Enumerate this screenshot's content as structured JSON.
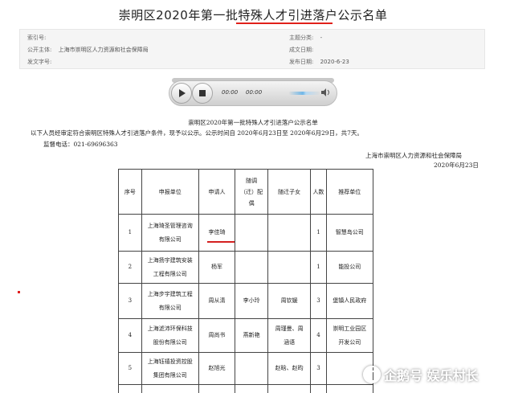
{
  "page": {
    "title": "崇明区2020年第一批特殊人才引进落户公示名单"
  },
  "meta": {
    "index_label": "索引号:",
    "index_value": "",
    "category_label": "主题分类:",
    "category_value": "-",
    "publisher_label": "公开主体:",
    "publisher_value": "上海市崇明区人力资源和社会保障局",
    "created_label": "成文日期:",
    "created_value": "",
    "docno_label": "发文字号:",
    "docno_value": "",
    "published_label": "发布日期:",
    "published_value": "2020-6-23"
  },
  "player": {
    "current_time": "00:00",
    "total_time": "00:00",
    "volume_level": 0.55,
    "play_icon": "play-icon",
    "stop_icon": "stop-icon",
    "volume_icon": "speaker-icon"
  },
  "doc": {
    "heading": "崇明区2020年第一批特殊人才引进落户公示名单",
    "intro": "以下人员经审定符合崇明区特殊人才引进落户条件，现予以公示。公示时间自 2020年6月23日至 2020年6月29日，共7天。",
    "phone": "监督电话：021-69696363",
    "issuer": "上海市崇明区人力资源和社会保障局",
    "issue_date": "2020年6月23日"
  },
  "table": {
    "headers": {
      "seq": "序号",
      "unit": "申报单位",
      "applicant": "申请人",
      "spouse_l1": "随调",
      "spouse_l2": "（迁）配",
      "spouse_l3": "偶",
      "children": "随迁子女",
      "count": "人数",
      "recommender": "推荐单位"
    },
    "rows": [
      {
        "seq": "1",
        "unit_l1": "上海琦圣管理咨询",
        "unit_l2": "有限公司",
        "applicant": "李佳琦",
        "spouse": "",
        "children_l1": "",
        "children_l2": "",
        "count": "1",
        "recommender_l1": "智慧岛公司",
        "recommender_l2": ""
      },
      {
        "seq": "2",
        "unit_l1": "上海扬宇建筑安装",
        "unit_l2": "工程有限公司",
        "applicant": "杨军",
        "spouse": "",
        "children_l1": "",
        "children_l2": "",
        "count": "1",
        "recommender_l1": "能投公司",
        "recommender_l2": ""
      },
      {
        "seq": "3",
        "unit_l1": "上海步宇建筑工程",
        "unit_l2": "有限公司",
        "applicant": "周从清",
        "spouse": "李小玲",
        "children_l1": "周钦媛",
        "children_l2": "",
        "count": "3",
        "recommender_l1": "堡镇人民政府",
        "recommender_l2": ""
      },
      {
        "seq": "4",
        "unit_l1": "上海滤沛环保科技",
        "unit_l2": "股份有限公司",
        "applicant": "周尚书",
        "spouse": "燕新艳",
        "children_l1": "周瑾曼、周",
        "children_l2": "涵语",
        "count": "4",
        "recommender_l1": "崇明工业园区",
        "recommender_l2": "开发公司"
      },
      {
        "seq": "5",
        "unit_l1": "上海钰禧投资控股",
        "unit_l2": "集团有限公司",
        "applicant": "赵旭光",
        "spouse": "",
        "children_l1": "赵晗、赵昀",
        "children_l2": "",
        "count": "3",
        "recommender_l1": "",
        "recommender_l2": ""
      },
      {
        "seq": "",
        "unit_l1": "",
        "unit_l2": "",
        "applicant": "",
        "spouse": "",
        "children_l1": "",
        "children_l2": "",
        "count": "",
        "recommender_l1": "",
        "recommender_l2": ""
      }
    ]
  },
  "watermark": {
    "text": "企鹅号 娱乐村长"
  },
  "colors": {
    "accent_red": "#e0201a",
    "meta_bg": "#f5f5f5"
  }
}
